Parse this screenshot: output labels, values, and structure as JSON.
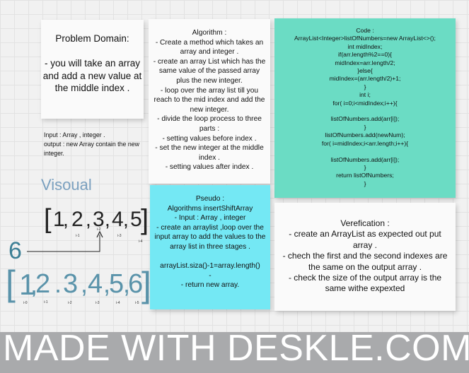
{
  "problem_domain": {
    "text": "Problem Domain:\n\n- you will  take an array and add a new value at the  middle index ."
  },
  "io": {
    "text": "Input : Array , integer .\noutput : new Array contain the new integer."
  },
  "algorithm": {
    "text": "Algorithm :\n- Create a method which takes an array and integer .\n- create an array List which has the same value of the passed array plus the new integer.\n- loop over the array list till you reach to the mid index and add the new integer.\n- divide the loop process to three parts :\n- setting values before index .\n- set the new integer at the middle index .\n- setting values after index ."
  },
  "code": {
    "text": "Code :\nArrayList<Integer>listOfNumbers=new ArrayList<>();\nint midIndex;\nif(arr.length%2==0){\nmidIndex=arr.length/2;\n}else{\nmidIndex=(arr.length/2)+1;\n}\nint i;\nfor( i=0;i<midIndex;i++){\n\nlistOfNumbers.add(arr[i]);\n}\nlistOfNumbers.add(newNum);\nfor( i=midIndex;i<arr.length;i++){\n\nlistOfNumbers.add(arr[i]);\n}\nreturn listOfNumbers;\n}"
  },
  "pseudo": {
    "text": "Pseudo :\nAlgorithms insertShiftArray\n- Input : Array , integer\n- create an arraylist ,loop over the input array  to add the values to the array list in three stages .\n\narrayList.siza()-1=array.length()\n-\n- return new array."
  },
  "verification": {
    "text": "Verefication :\n- create an ArrayList as expected out put array .\n- chech the first and the second indexes are the same on the output array .\n- check the size of the output array is the same withe expexted"
  },
  "visual": {
    "title": "Visoual",
    "array1": [
      "[",
      "1",
      ",",
      "2",
      ",",
      "3",
      ",",
      "4",
      ",",
      "5",
      "]"
    ],
    "index1": [
      "i-1",
      "i-2",
      "i-3",
      "i-4"
    ],
    "new_value": "6",
    "array2": [
      "[",
      "1",
      ",",
      "2",
      ".",
      "3",
      ",",
      "4",
      ",",
      "5",
      ",",
      "6",
      "]"
    ],
    "index2": [
      "i-0",
      "i-1",
      "i-2",
      "i-3",
      "i-4",
      "i-5"
    ]
  },
  "banner": {
    "text": "MADE WITH DESKLE.COM"
  },
  "colors": {
    "code_note": "#6bdcc4",
    "pseudo_note": "#74e8f4",
    "visual_title": "#7aa0bf",
    "banner": "#a9aaac"
  }
}
